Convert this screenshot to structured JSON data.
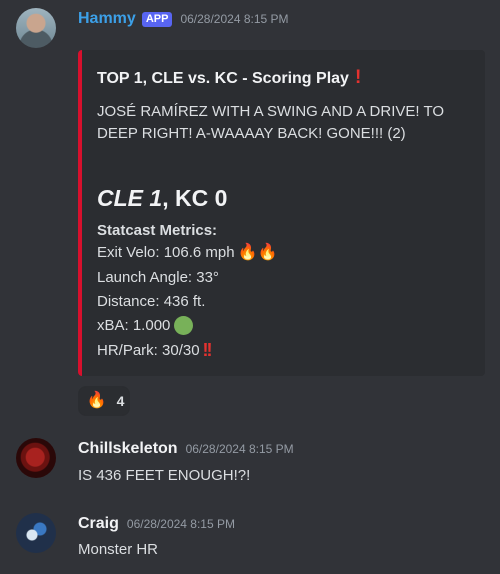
{
  "messages": [
    {
      "author": "Hammy",
      "badge": "APP",
      "timestamp": "06/28/2024 8:15 PM",
      "embed": {
        "title": "TOP 1, CLE vs. KC - Scoring Play",
        "title_icon": "❗",
        "description": "JOSÉ RAMÍREZ WITH A SWING AND A DRIVE! TO DEEP RIGHT! A-WAAAAY BACK! GONE!!! (2)",
        "score_italic": "CLE 1",
        "score_rest": ", KC 0",
        "statcast_title": "Statcast Metrics:",
        "stats": [
          {
            "label": "Exit Velo: 106.6 mph",
            "emoji": "🔥🔥"
          },
          {
            "label": "Launch Angle: 33°",
            "emoji": ""
          },
          {
            "label": "Distance: 436 ft.",
            "emoji": ""
          },
          {
            "label": "xBA: 1.000",
            "emoji": "green-circle"
          },
          {
            "label": "HR/Park: 30/30",
            "emoji": "‼"
          }
        ],
        "accent_color": "#d7102d"
      },
      "reaction": {
        "emoji": "🔥",
        "count": "4"
      }
    },
    {
      "author": "Chillskeleton",
      "timestamp": "06/28/2024 8:15 PM",
      "text": "IS 436 FEET ENOUGH!?!"
    },
    {
      "author": "Craig",
      "timestamp": "06/28/2024 8:15 PM",
      "text": "Monster HR"
    }
  ]
}
